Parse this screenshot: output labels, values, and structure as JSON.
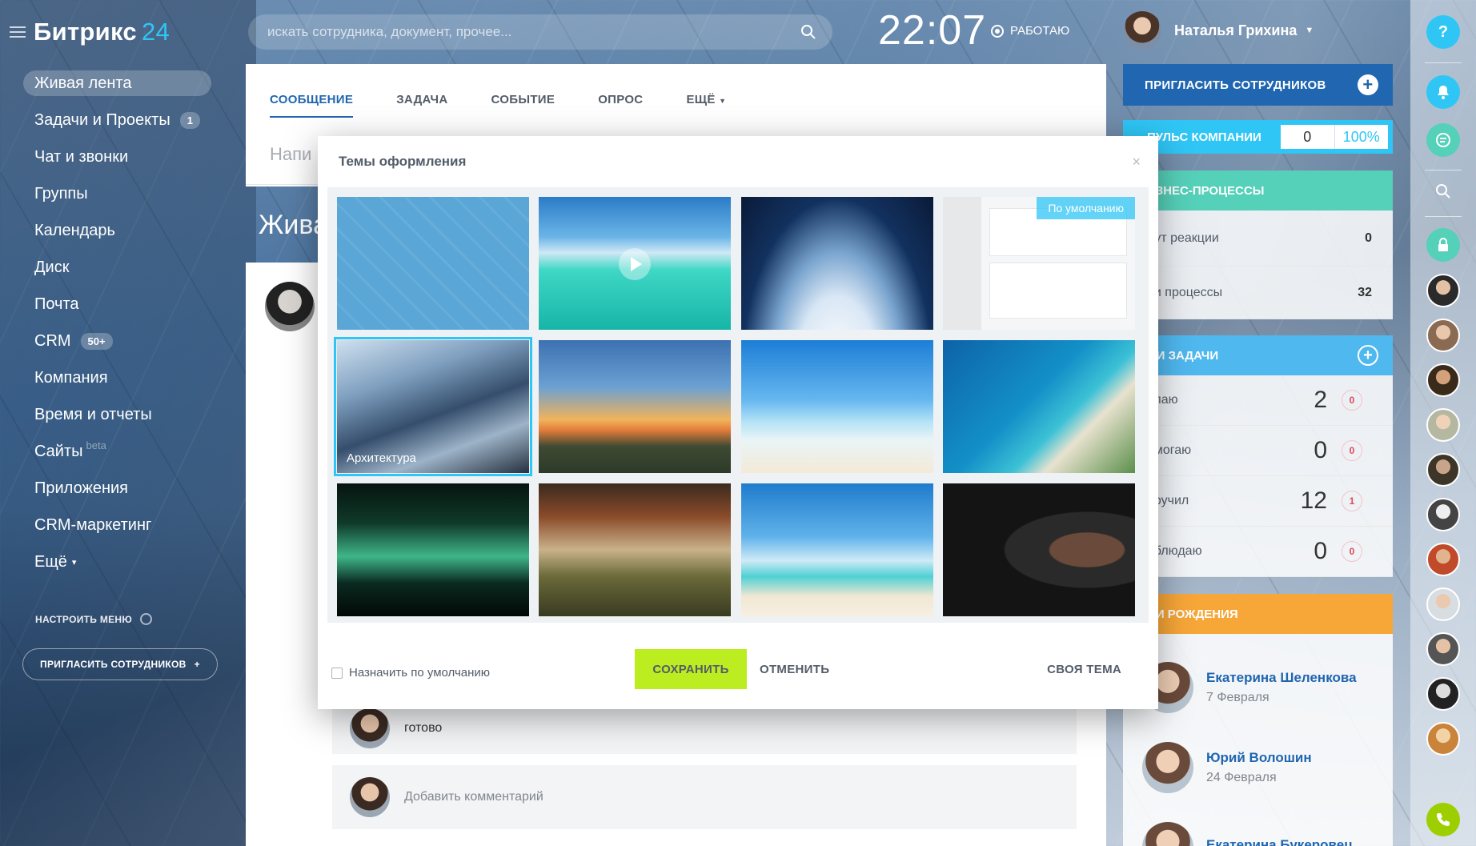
{
  "app": {
    "logo_text": "Битрикс",
    "logo_num": "24"
  },
  "colors": {
    "accent": "#2066b0",
    "cyan": "#2fc6f6",
    "green_button": "#bbed21",
    "teal": "#55d0b9",
    "orange": "#f7a638",
    "alert_red": "#e14857"
  },
  "sidebar": {
    "items": [
      {
        "label": "Живая лента",
        "active": true
      },
      {
        "label": "Задачи и Проекты",
        "badge": "1"
      },
      {
        "label": "Чат и звонки"
      },
      {
        "label": "Группы"
      },
      {
        "label": "Календарь"
      },
      {
        "label": "Диск"
      },
      {
        "label": "Почта"
      },
      {
        "label": "CRM",
        "badge": "50+"
      },
      {
        "label": "Компания"
      },
      {
        "label": "Время и отчеты"
      },
      {
        "label": "Сайты",
        "tag": "beta"
      },
      {
        "label": "Приложения"
      },
      {
        "label": "CRM-маркетинг"
      },
      {
        "label": "Ещё"
      }
    ],
    "setup_menu": "НАСТРОИТЬ МЕНЮ",
    "invite": "ПРИГЛАСИТЬ СОТРУДНИКОВ"
  },
  "header": {
    "search_placeholder": "искать сотрудника, документ, прочее...",
    "time": "22:07",
    "status": "РАБОТАЮ",
    "user_name": "Наталья Грихина"
  },
  "feed": {
    "tabs": [
      "СООБЩЕНИЕ",
      "ЗАДАЧА",
      "СОБЫТИЕ",
      "ОПРОС",
      "ЕЩЁ"
    ],
    "write_hint": "Напи",
    "title_partial": "Жива",
    "comment_text": "готово",
    "add_comment": "Добавить комментарий"
  },
  "right": {
    "invite": "ПРИГЛАСИТЬ СОТРУДНИКОВ",
    "pulse_label": "ПУЛЬС КОМПАНИИ",
    "pulse_value": "0",
    "pulse_percent": "100%",
    "bp_head": "ИЗНЕС-ПРОЦЕССЫ",
    "bp_rows": [
      {
        "label": "дут реакции",
        "value": "0"
      },
      {
        "label": "ои процессы",
        "value": "32"
      }
    ],
    "tasks_head": "ОИ ЗАДАЧИ",
    "task_rows": [
      {
        "label": "елаю",
        "value": "2",
        "badge": "0"
      },
      {
        "label": "омогаю",
        "value": "0",
        "badge": "0"
      },
      {
        "label": "оручил",
        "value": "12",
        "badge": "1"
      },
      {
        "label": "аблюдаю",
        "value": "0",
        "badge": "0"
      }
    ],
    "bday_head": "НИ РОЖДЕНИЯ",
    "birthdays": [
      {
        "name": "Екатерина Шеленкова",
        "date": "7 Февраля"
      },
      {
        "name": "Юрий Волошин",
        "date": "24 Февраля"
      },
      {
        "name": "Екатерина Букеровец",
        "date": ""
      }
    ]
  },
  "rail": {
    "help_label": "?"
  },
  "modal": {
    "title": "Темы оформления",
    "close": "×",
    "thumbs": [
      {
        "label": ""
      },
      {
        "label": ""
      },
      {
        "label": ""
      },
      {
        "label": "",
        "badge": "По умолчанию"
      },
      {
        "label": "Архитектура",
        "selected": true
      },
      {
        "label": ""
      },
      {
        "label": ""
      },
      {
        "label": ""
      },
      {
        "label": ""
      },
      {
        "label": ""
      },
      {
        "label": ""
      },
      {
        "label": ""
      }
    ],
    "set_default": "Назначить по умолчанию",
    "save": "СОХРАНИТЬ",
    "cancel": "ОТМЕНИТЬ",
    "own_theme": "СВОЯ ТЕМА"
  }
}
